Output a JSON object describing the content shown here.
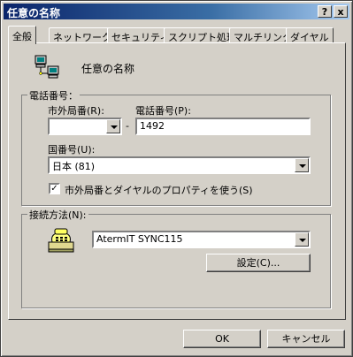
{
  "window": {
    "title": "任意の名称",
    "help_glyph": "?",
    "close_glyph": "x"
  },
  "tabs": [
    {
      "label": "全般"
    },
    {
      "label": "ネットワーク"
    },
    {
      "label": "セキュリティ"
    },
    {
      "label": "スクリプト処理"
    },
    {
      "label": "マルチリンク"
    },
    {
      "label": "ダイヤル"
    }
  ],
  "general": {
    "connection_name": "任意の名称",
    "phone_group": {
      "label": "電話番号：",
      "area_code_label": "市外局番(R):",
      "area_code_value": "",
      "separator": "-",
      "phone_label": "電話番号(P):",
      "phone_value": "1492",
      "country_label": "国番号(U):",
      "country_value": "日本 (81)",
      "use_dialing_rules_label": "市外局番とダイヤルのプロパティを使う(S)",
      "use_dialing_rules_checked": true,
      "check_glyph": "✓"
    },
    "connect_group": {
      "label": "接続方法(N):",
      "device_value": "AtermIT SYNC115",
      "configure_label": "設定(C)..."
    }
  },
  "footer": {
    "ok_label": "OK",
    "cancel_label": "キャンセル"
  },
  "icons": {
    "connection": "network-computers-icon",
    "modem": "phone-modem-icon"
  }
}
